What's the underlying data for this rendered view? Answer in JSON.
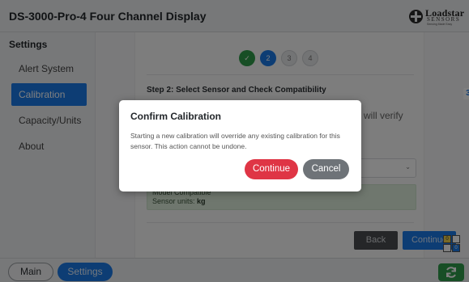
{
  "header": {
    "title": "DS-3000-Pro-4 Four Channel Display",
    "logo": {
      "brand": "Loadstar",
      "brand_line2": "SENSORS",
      "tagline": "Sensing Made Easy"
    }
  },
  "sidebar": {
    "title": "Settings",
    "items": [
      {
        "label": "Alert System",
        "active": false
      },
      {
        "label": "Calibration",
        "active": true
      },
      {
        "label": "Capacity/Units",
        "active": false
      },
      {
        "label": "About",
        "active": false
      }
    ]
  },
  "wizard": {
    "steps": [
      {
        "label": "✓",
        "state": "done"
      },
      {
        "label": "2",
        "state": "current"
      },
      {
        "label": "3",
        "state": "future"
      },
      {
        "label": "4",
        "state": "future"
      }
    ],
    "heading": "Step 2: Select Sensor and Check Compatibility",
    "partial_text": "will verify",
    "compat_line1": "Model Compatible",
    "compat_units_label": "Sensor units:",
    "compat_units_value": "kg",
    "back_label": "Back",
    "continue_label": "Continue",
    "edge_badge": "3"
  },
  "footer": {
    "main_label": "Main",
    "settings_label": "Settings",
    "grid_cells": [
      "0",
      "",
      "",
      "0"
    ]
  },
  "modal": {
    "title": "Confirm Calibration",
    "body": "Starting a new calibration will override any existing calibration for this sensor. This action cannot be undone.",
    "continue_label": "Continue",
    "cancel_label": "Cancel"
  },
  "colors": {
    "accent": "#1a7ae8",
    "success": "#2e9c4a",
    "danger": "#df3545",
    "neutral_button": "#6e7378"
  },
  "icons": [
    "loadstar-logo-icon",
    "chevron-down-icon",
    "refresh-icon",
    "check-icon"
  ]
}
